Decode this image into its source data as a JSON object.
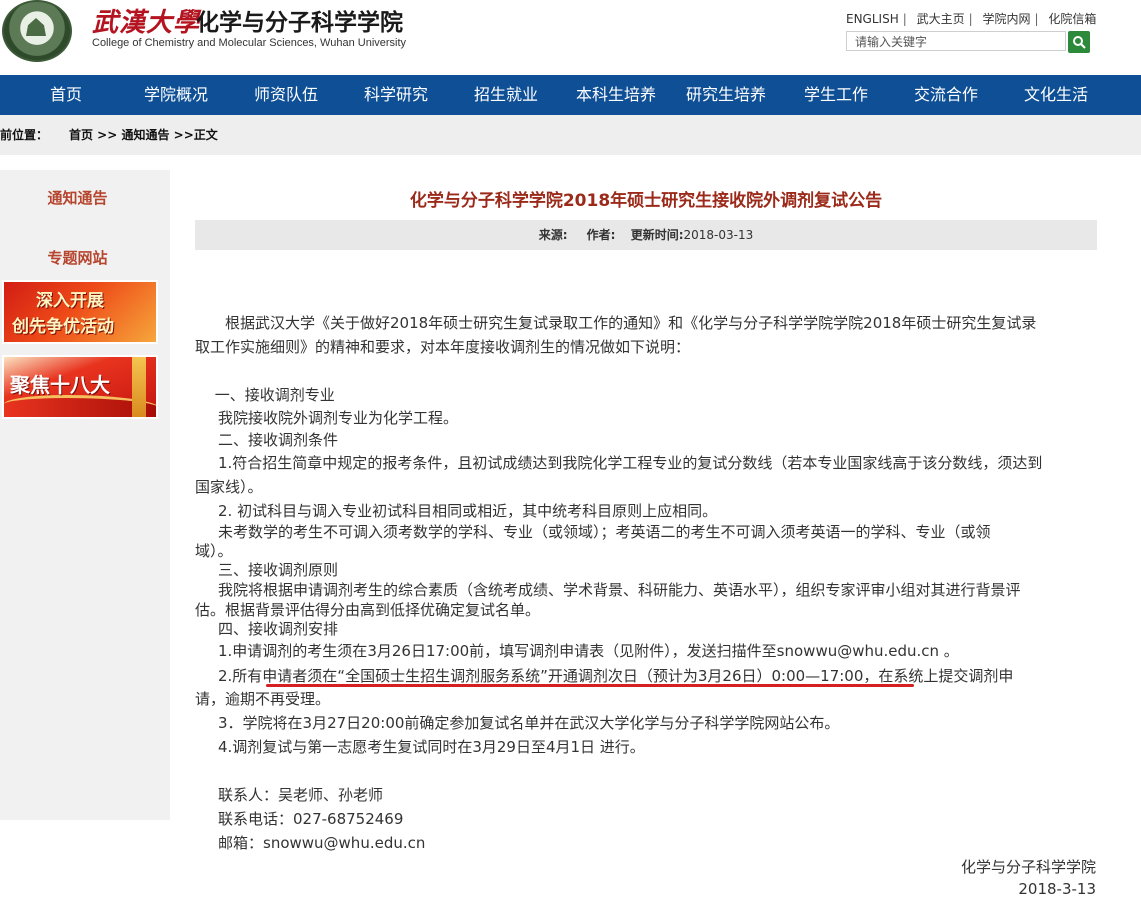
{
  "header": {
    "logo_script": "武漢大學",
    "logo_cn": "化学与分子科学学院",
    "logo_en": "College of Chemistry and Molecular Sciences, Wuhan University",
    "top_links": [
      "ENGLISH",
      "武大主页",
      "学院内网",
      "化院信箱"
    ],
    "search_placeholder": "请输入关键字"
  },
  "nav": [
    "首页",
    "学院概况",
    "师资队伍",
    "科学研究",
    "招生就业",
    "本科生培养",
    "研究生培养",
    "学生工作",
    "交流合作",
    "文化生活"
  ],
  "breadcrumb": {
    "label": "前位置：",
    "path": "首页 >> 通知通告 >>正文"
  },
  "sidebar": {
    "title1": "通知通告",
    "title2": "专题网站",
    "banner1_line1": "深入开展",
    "banner1_line2": "创先争优活动",
    "banner2_text": "聚焦十八大"
  },
  "article": {
    "title": "化学与分子科学学院2018年硕士研究生接收院外调剂复试公告",
    "meta_source": "来源:",
    "meta_author": "作者:",
    "meta_time_label": "更新时间:",
    "meta_time": "2018-03-13",
    "lines": [
      "　　根据武汉大学《关于做好2018年硕士研究生复试录取工作的通知》和《化学与分子科学学院学院2018年硕士研究生复试录",
      "取工作实施细则》的精神和要求，对本年度接收调剂生的情况做如下说明：",
      "　  一、接收调剂专业",
      "　我院接收院外调剂专业为化学工程。",
      "　二、接收调剂条件",
      "　1.符合招生简章中规定的报考条件，且初试成绩达到我院化学工程专业的复试分数线（若本专业国家线高于该分数线，须达到",
      "国家线）。",
      "　2. 初试科目与调入专业初试科目相同或相近，其中统考科目原则上应相同。",
      "　未考数学的考生不可调入须考数学的学科、专业（或领域）；考英语二的考生不可调入须考英语一的学科、专业（或领",
      "域）。",
      "　三、接收调剂原则",
      "　我院将根据申请调剂考生的综合素质（含统考成绩、学术背景、科研能力、英语水平），组织专家评审小组对其进行背景评",
      "估。根据背景评估得分由高到低择优确定复试名单。",
      "　四、接收调剂安排",
      "　1.申请调剂的考生须在3月26日17:00前，填写调剂申请表（见附件），发送扫描件至snowwu@whu.edu.cn 。",
      "　2.所有申请者须在“全国硕士生招生调剂服务系统”开通调剂次日（预计为3月26日）0:00—17:00，在系统上提交调剂申",
      "请，逾期不再受理。",
      "　3．学院将在3月27日20:00前确定参加复试名单并在武汉大学化学与分子科学学院网站公布。",
      "　4.调剂复试与第一志愿考生复试同时在3月29日至4月1日 进行。",
      "　联系人：吴老师、孙老师",
      "　联系电话：027-68752469",
      "　邮箱：snowwu@whu.edu.cn"
    ],
    "signature": "化学与分子科学学院",
    "sign_date": "2018-3-13"
  }
}
